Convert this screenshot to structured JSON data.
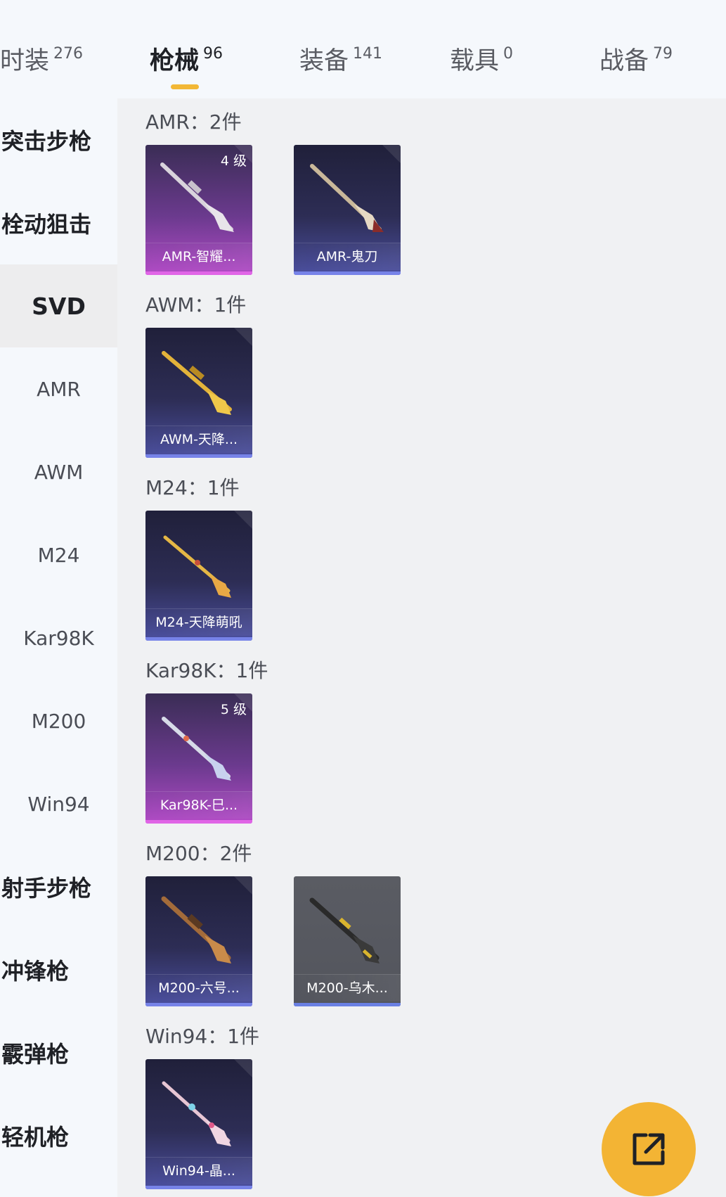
{
  "tabs": [
    {
      "label": "时装",
      "count": "276"
    },
    {
      "label": "枪械",
      "count": "96"
    },
    {
      "label": "装备",
      "count": "141"
    },
    {
      "label": "载具",
      "count": "0"
    },
    {
      "label": "战备",
      "count": "79"
    }
  ],
  "sidebar": {
    "items": [
      {
        "label": "突击步枪"
      },
      {
        "label": "栓动狙击"
      },
      {
        "label": "SVD"
      },
      {
        "label": "AMR"
      },
      {
        "label": "AWM"
      },
      {
        "label": "M24"
      },
      {
        "label": "Kar98K"
      },
      {
        "label": "M200"
      },
      {
        "label": "Win94"
      },
      {
        "label": "射手步枪"
      },
      {
        "label": "冲锋枪"
      },
      {
        "label": "霰弹枪"
      },
      {
        "label": "轻机枪"
      }
    ]
  },
  "groups": [
    {
      "title": "AMR：2件",
      "items": [
        {
          "name": "AMR-智耀...",
          "level": "4 级",
          "rarity": "purple",
          "icon": "rifle-icon"
        },
        {
          "name": "AMR-鬼刀",
          "level": "",
          "rarity": "blue",
          "icon": "rifle-icon"
        }
      ]
    },
    {
      "title": "AWM：1件",
      "items": [
        {
          "name": "AWM-天降...",
          "level": "",
          "rarity": "blue",
          "icon": "rifle-icon"
        }
      ]
    },
    {
      "title": "M24：1件",
      "items": [
        {
          "name": "M24-天降萌吼",
          "level": "",
          "rarity": "blue",
          "icon": "rifle-icon"
        }
      ]
    },
    {
      "title": "Kar98K：1件",
      "items": [
        {
          "name": "Kar98K-巳...",
          "level": "5 级",
          "rarity": "purple",
          "icon": "rifle-icon"
        }
      ]
    },
    {
      "title": "M200：2件",
      "items": [
        {
          "name": "M200-六号...",
          "level": "",
          "rarity": "blue",
          "icon": "rifle-icon"
        },
        {
          "name": "M200-乌木...",
          "level": "",
          "rarity": "gray",
          "icon": "rifle-icon"
        }
      ]
    },
    {
      "title": "Win94：1件",
      "items": [
        {
          "name": "Win94-晶...",
          "level": "",
          "rarity": "blue",
          "icon": "rifle-icon"
        }
      ]
    }
  ],
  "fab": {
    "icon": "share-external-icon"
  },
  "colors": {
    "accent": "#f2b735",
    "purple_rarity": "#e065e6",
    "blue_rarity": "#7783e8",
    "gray_rarity": "#6a80e3"
  }
}
